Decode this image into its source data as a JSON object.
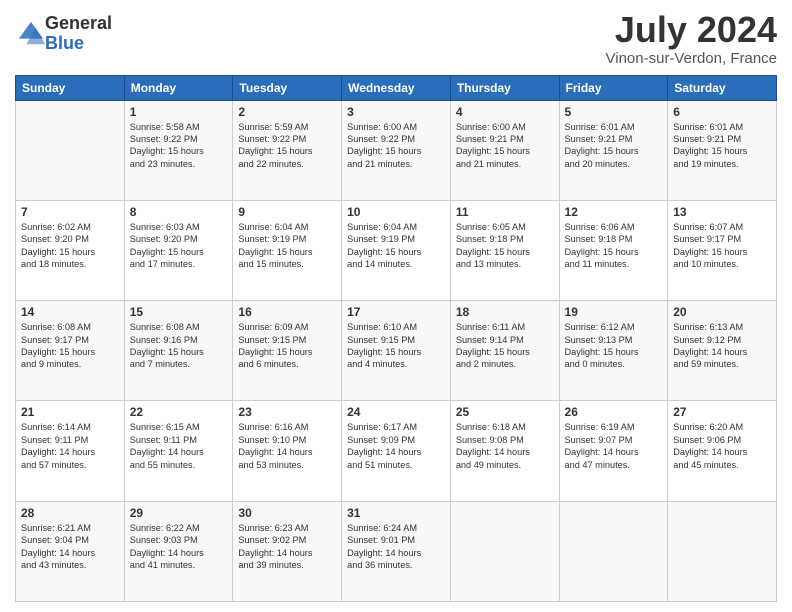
{
  "logo": {
    "general": "General",
    "blue": "Blue"
  },
  "title": "July 2024",
  "location": "Vinon-sur-Verdon, France",
  "days_of_week": [
    "Sunday",
    "Monday",
    "Tuesday",
    "Wednesday",
    "Thursday",
    "Friday",
    "Saturday"
  ],
  "weeks": [
    [
      {
        "day": "",
        "info": ""
      },
      {
        "day": "1",
        "info": "Sunrise: 5:58 AM\nSunset: 9:22 PM\nDaylight: 15 hours\nand 23 minutes."
      },
      {
        "day": "2",
        "info": "Sunrise: 5:59 AM\nSunset: 9:22 PM\nDaylight: 15 hours\nand 22 minutes."
      },
      {
        "day": "3",
        "info": "Sunrise: 6:00 AM\nSunset: 9:22 PM\nDaylight: 15 hours\nand 21 minutes."
      },
      {
        "day": "4",
        "info": "Sunrise: 6:00 AM\nSunset: 9:21 PM\nDaylight: 15 hours\nand 21 minutes."
      },
      {
        "day": "5",
        "info": "Sunrise: 6:01 AM\nSunset: 9:21 PM\nDaylight: 15 hours\nand 20 minutes."
      },
      {
        "day": "6",
        "info": "Sunrise: 6:01 AM\nSunset: 9:21 PM\nDaylight: 15 hours\nand 19 minutes."
      }
    ],
    [
      {
        "day": "7",
        "info": "Sunrise: 6:02 AM\nSunset: 9:20 PM\nDaylight: 15 hours\nand 18 minutes."
      },
      {
        "day": "8",
        "info": "Sunrise: 6:03 AM\nSunset: 9:20 PM\nDaylight: 15 hours\nand 17 minutes."
      },
      {
        "day": "9",
        "info": "Sunrise: 6:04 AM\nSunset: 9:19 PM\nDaylight: 15 hours\nand 15 minutes."
      },
      {
        "day": "10",
        "info": "Sunrise: 6:04 AM\nSunset: 9:19 PM\nDaylight: 15 hours\nand 14 minutes."
      },
      {
        "day": "11",
        "info": "Sunrise: 6:05 AM\nSunset: 9:18 PM\nDaylight: 15 hours\nand 13 minutes."
      },
      {
        "day": "12",
        "info": "Sunrise: 6:06 AM\nSunset: 9:18 PM\nDaylight: 15 hours\nand 11 minutes."
      },
      {
        "day": "13",
        "info": "Sunrise: 6:07 AM\nSunset: 9:17 PM\nDaylight: 15 hours\nand 10 minutes."
      }
    ],
    [
      {
        "day": "14",
        "info": "Sunrise: 6:08 AM\nSunset: 9:17 PM\nDaylight: 15 hours\nand 9 minutes."
      },
      {
        "day": "15",
        "info": "Sunrise: 6:08 AM\nSunset: 9:16 PM\nDaylight: 15 hours\nand 7 minutes."
      },
      {
        "day": "16",
        "info": "Sunrise: 6:09 AM\nSunset: 9:15 PM\nDaylight: 15 hours\nand 6 minutes."
      },
      {
        "day": "17",
        "info": "Sunrise: 6:10 AM\nSunset: 9:15 PM\nDaylight: 15 hours\nand 4 minutes."
      },
      {
        "day": "18",
        "info": "Sunrise: 6:11 AM\nSunset: 9:14 PM\nDaylight: 15 hours\nand 2 minutes."
      },
      {
        "day": "19",
        "info": "Sunrise: 6:12 AM\nSunset: 9:13 PM\nDaylight: 15 hours\nand 0 minutes."
      },
      {
        "day": "20",
        "info": "Sunrise: 6:13 AM\nSunset: 9:12 PM\nDaylight: 14 hours\nand 59 minutes."
      }
    ],
    [
      {
        "day": "21",
        "info": "Sunrise: 6:14 AM\nSunset: 9:11 PM\nDaylight: 14 hours\nand 57 minutes."
      },
      {
        "day": "22",
        "info": "Sunrise: 6:15 AM\nSunset: 9:11 PM\nDaylight: 14 hours\nand 55 minutes."
      },
      {
        "day": "23",
        "info": "Sunrise: 6:16 AM\nSunset: 9:10 PM\nDaylight: 14 hours\nand 53 minutes."
      },
      {
        "day": "24",
        "info": "Sunrise: 6:17 AM\nSunset: 9:09 PM\nDaylight: 14 hours\nand 51 minutes."
      },
      {
        "day": "25",
        "info": "Sunrise: 6:18 AM\nSunset: 9:08 PM\nDaylight: 14 hours\nand 49 minutes."
      },
      {
        "day": "26",
        "info": "Sunrise: 6:19 AM\nSunset: 9:07 PM\nDaylight: 14 hours\nand 47 minutes."
      },
      {
        "day": "27",
        "info": "Sunrise: 6:20 AM\nSunset: 9:06 PM\nDaylight: 14 hours\nand 45 minutes."
      }
    ],
    [
      {
        "day": "28",
        "info": "Sunrise: 6:21 AM\nSunset: 9:04 PM\nDaylight: 14 hours\nand 43 minutes."
      },
      {
        "day": "29",
        "info": "Sunrise: 6:22 AM\nSunset: 9:03 PM\nDaylight: 14 hours\nand 41 minutes."
      },
      {
        "day": "30",
        "info": "Sunrise: 6:23 AM\nSunset: 9:02 PM\nDaylight: 14 hours\nand 39 minutes."
      },
      {
        "day": "31",
        "info": "Sunrise: 6:24 AM\nSunset: 9:01 PM\nDaylight: 14 hours\nand 36 minutes."
      },
      {
        "day": "",
        "info": ""
      },
      {
        "day": "",
        "info": ""
      },
      {
        "day": "",
        "info": ""
      }
    ]
  ]
}
